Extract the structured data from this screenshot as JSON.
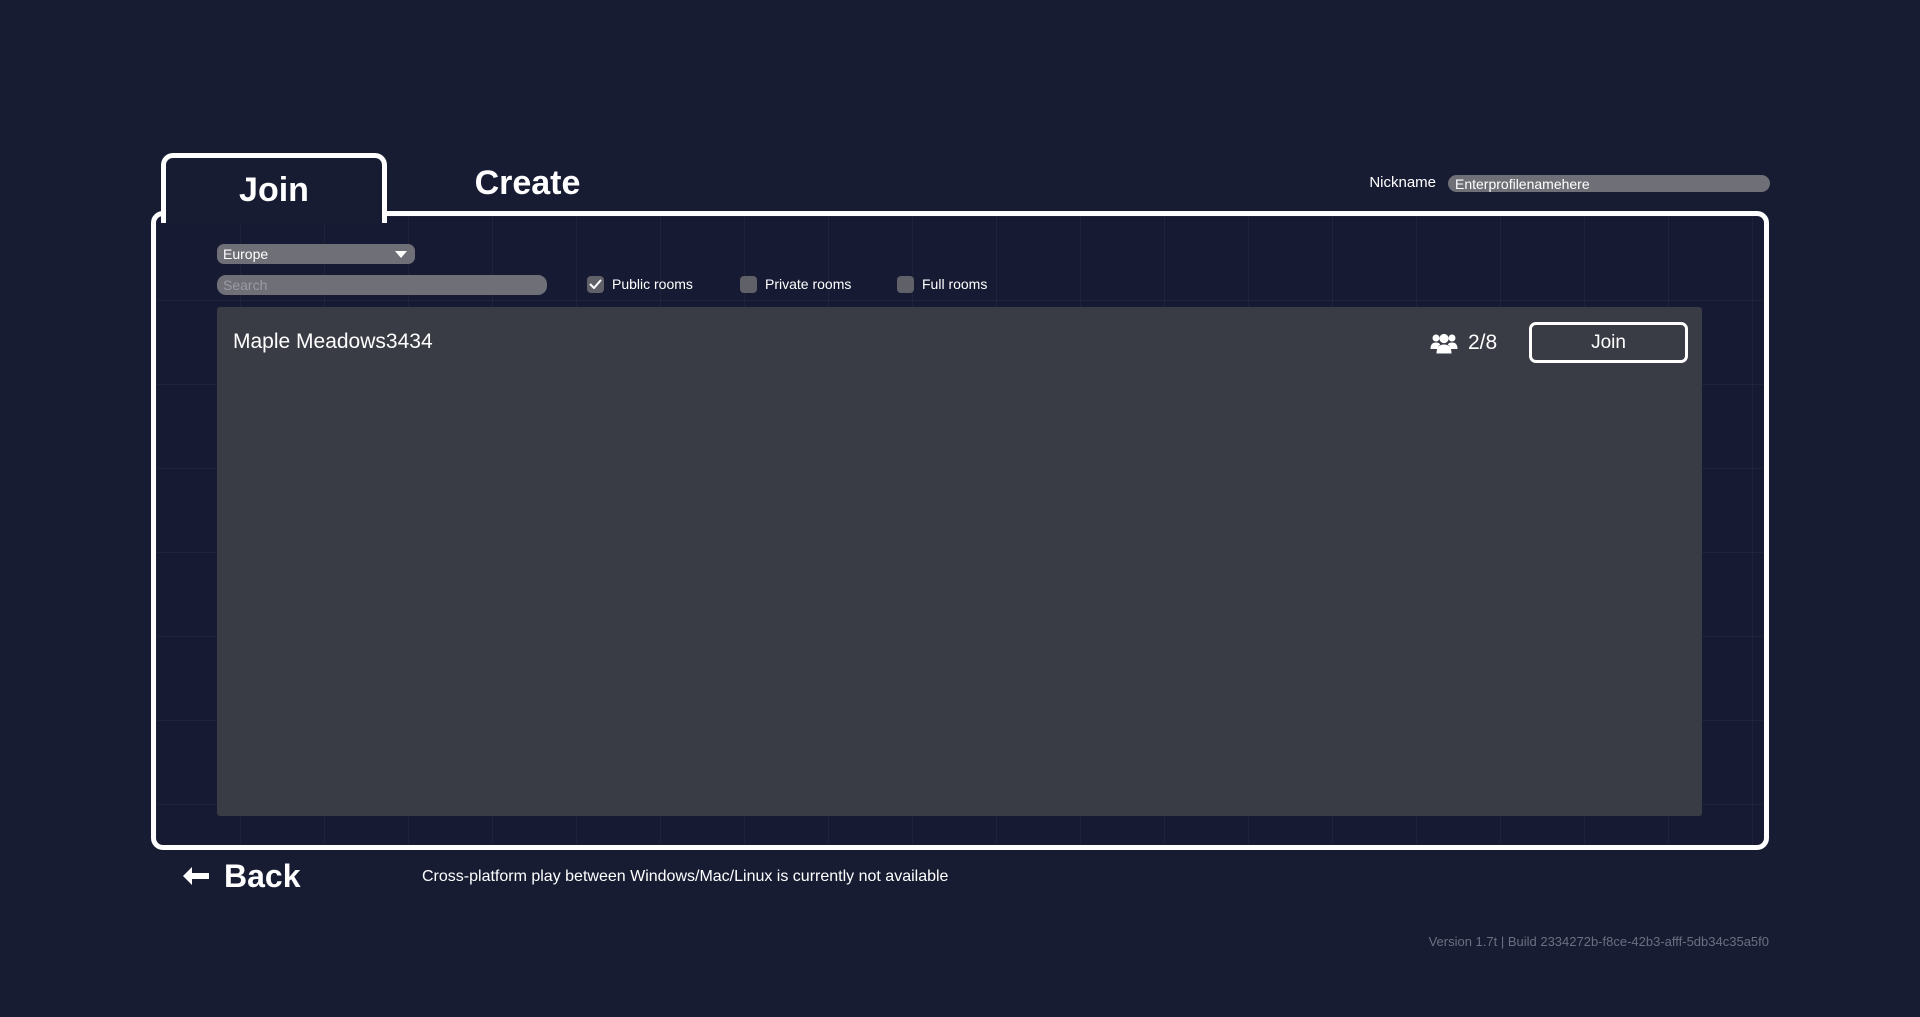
{
  "tabs": {
    "join_label": "Join",
    "create_label": "Create"
  },
  "nickname": {
    "label": "Nickname",
    "value": "Enterprofilenamehere"
  },
  "filters": {
    "region": "Europe",
    "search_placeholder": "Search",
    "public_rooms": {
      "label": "Public rooms",
      "checked": true
    },
    "private_rooms": {
      "label": "Private rooms",
      "checked": false
    },
    "full_rooms": {
      "label": "Full rooms",
      "checked": false
    }
  },
  "rooms": [
    {
      "name": "Maple Meadows3434",
      "players": "2/8",
      "join_label": "Join",
      "icon": "players-icon"
    }
  ],
  "footer": {
    "back_label": "Back",
    "back_icon": "arrow-left-icon",
    "cross_platform_note": "Cross-platform play between Windows/Mac/Linux is currently not available",
    "version": "Version 1.7t | Build 2334272b-f8ce-42b3-afff-5db34c35a5f0"
  },
  "colors": {
    "background": "#171c33",
    "panel_border": "#ffffff",
    "room_list_bg": "#393b45",
    "input_bg": "#6f6f78",
    "version_text": "#6c6f80"
  }
}
